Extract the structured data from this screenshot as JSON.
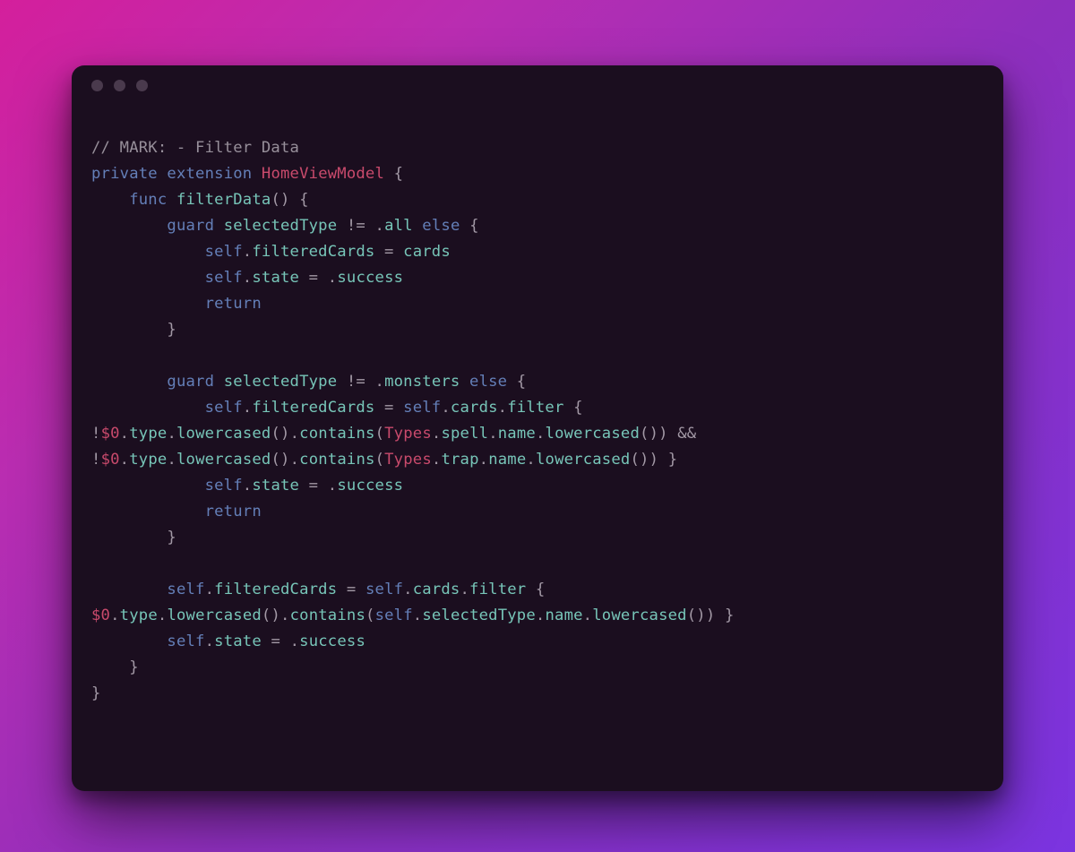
{
  "code": {
    "t": {
      "comment": "// MARK: - Filter Data",
      "kw_private": "private",
      "kw_extension": "extension",
      "type_homeviewmodel": "HomeViewModel",
      "brace_open": "{",
      "brace_close": "}",
      "kw_func": "func",
      "fn_filterdata": "filterData",
      "paren_open": "(",
      "paren_close": ")",
      "kw_guard": "guard",
      "id_selectedtype": "selectedType",
      "op_neq": "!=",
      "dot": ".",
      "enum_all": "all",
      "kw_else": "else",
      "kw_self": "self",
      "prop_filteredcards": "filteredCards",
      "op_eq": "=",
      "id_cards": "cards",
      "prop_state": "state",
      "enum_success": "success",
      "kw_return": "return",
      "enum_monsters": "monsters",
      "fn_filter": "filter",
      "op_not": "!",
      "dollar0": "$0",
      "prop_type": "type",
      "fn_lowercased": "lowercased",
      "fn_contains": "contains",
      "type_types": "Types",
      "enum_spell": "spell",
      "prop_name": "name",
      "op_and": "&&",
      "enum_trap": "trap"
    }
  },
  "window": {
    "traffic_light_count": 3
  },
  "colors": {
    "bg_start": "#d41f9c",
    "bg_end": "#7b34e0",
    "card_bg": "#1b0e1f",
    "comment": "#978f9a",
    "keyword": "#647fb8",
    "type": "#c94a6c",
    "identifier": "#77c5b8",
    "punctuation": "#a399a6"
  }
}
